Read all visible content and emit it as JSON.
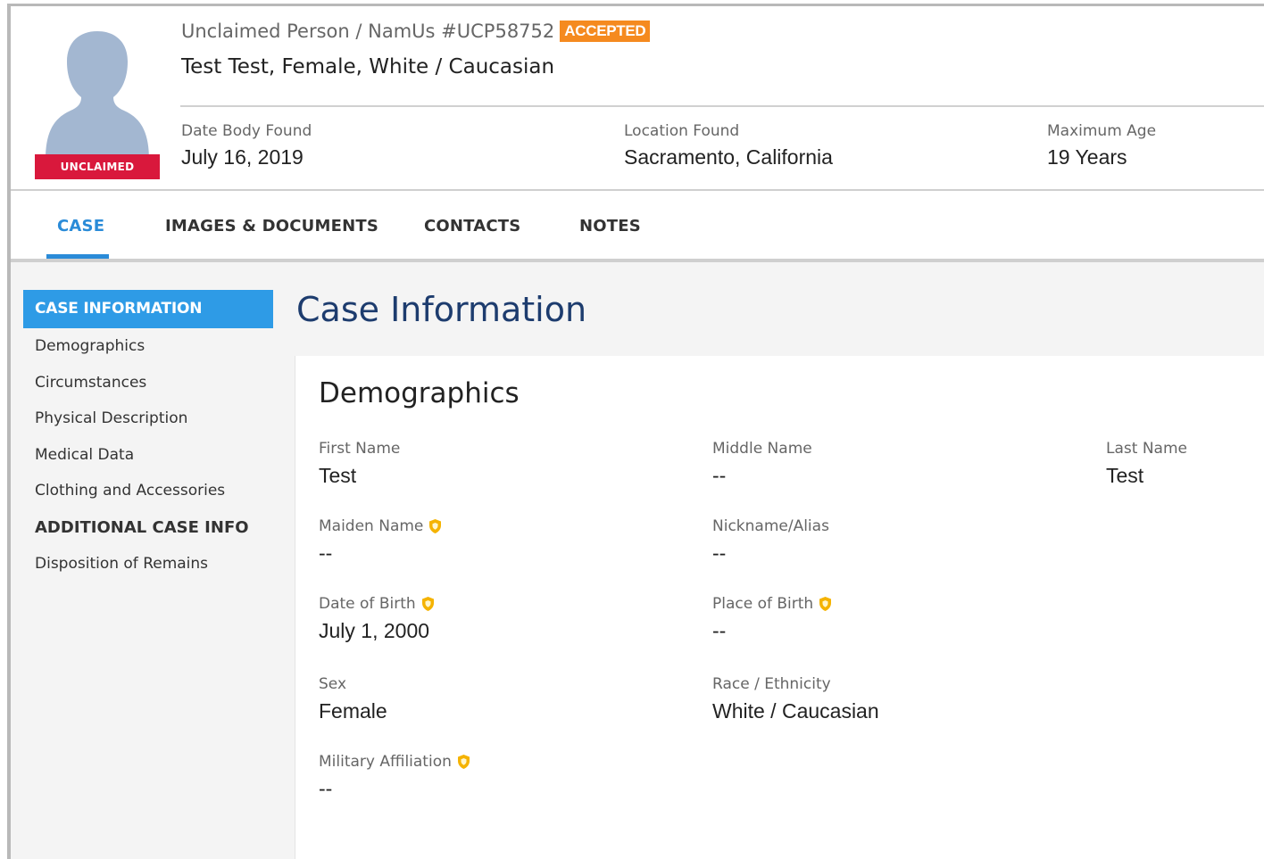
{
  "header": {
    "case_subtitle": "Unclaimed Person / NamUs #UCP58752",
    "status_badge": "ACCEPTED",
    "case_title": "Test Test, Female, White / Caucasian",
    "avatar_badge": "UNCLAIMED",
    "summary": [
      {
        "label": "Date Body Found",
        "value": "July 16, 2019"
      },
      {
        "label": "Location Found",
        "value": "Sacramento, California"
      },
      {
        "label": "Maximum Age",
        "value": "19 Years"
      }
    ]
  },
  "tabs": [
    {
      "label": "CASE",
      "active": true
    },
    {
      "label": "IMAGES & DOCUMENTS",
      "active": false
    },
    {
      "label": "CONTACTS",
      "active": false
    },
    {
      "label": "NOTES",
      "active": false
    }
  ],
  "sidenav": {
    "active": "CASE INFORMATION",
    "items": [
      "Demographics",
      "Circumstances",
      "Physical Description",
      "Medical Data",
      "Clothing and Accessories"
    ],
    "section2": "ADDITIONAL CASE INFO",
    "items2": [
      "Disposition of Remains"
    ]
  },
  "main": {
    "page_title": "Case Information",
    "panel_title": "Demographics",
    "fields": {
      "first_name": {
        "label": "First Name",
        "value": "Test"
      },
      "middle_name": {
        "label": "Middle Name",
        "value": "--"
      },
      "last_name": {
        "label": "Last Name",
        "value": "Test"
      },
      "maiden_name": {
        "label": "Maiden Name",
        "value": "--",
        "protected": true
      },
      "nickname": {
        "label": "Nickname/Alias",
        "value": "--"
      },
      "dob": {
        "label": "Date of Birth",
        "value": "July 1, 2000",
        "protected": true
      },
      "pob": {
        "label": "Place of Birth",
        "value": "--",
        "protected": true
      },
      "sex": {
        "label": "Sex",
        "value": "Female"
      },
      "race": {
        "label": "Race / Ethnicity",
        "value": "White / Caucasian"
      },
      "military": {
        "label": "Military Affiliation",
        "value": "--",
        "protected": true
      }
    }
  },
  "colors": {
    "accent": "#2a8bd8",
    "unclaimed": "#d9183c",
    "accepted": "#f58a1f",
    "shield": "#f5b301",
    "title": "#1d3c6e"
  }
}
